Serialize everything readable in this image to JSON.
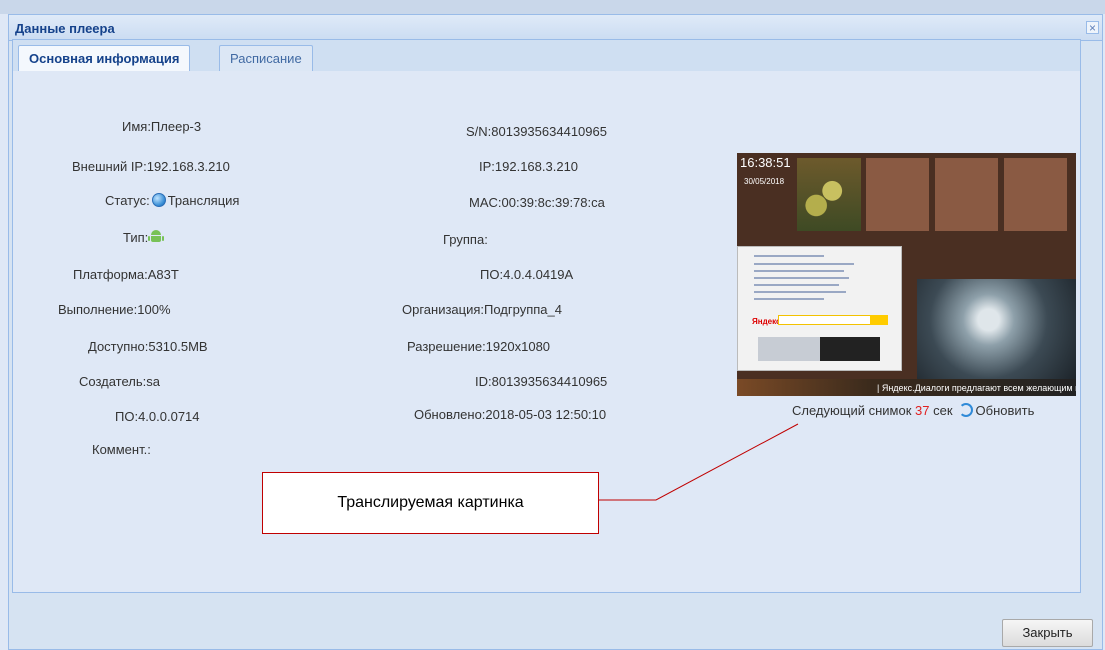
{
  "window": {
    "title": "Данные плеера",
    "close_glyph": "×"
  },
  "tabs": [
    {
      "label": "Основная информация",
      "active": true
    },
    {
      "label": "Расписание",
      "active": false
    }
  ],
  "left_fields": {
    "name": "Имя:Плеер-3",
    "ext_ip": "Внешний IP:192.168.3.210",
    "status_label": "Статус:",
    "status_value": "Трансляция",
    "type_label": "Тип:",
    "platform": "Платформа:A83T",
    "progress": "Выполнение:100%",
    "available": "Доступно:5310.5MB",
    "creator": "Создатель:sa",
    "software": "ПО:4.0.0.0714",
    "comment": "Коммент.:"
  },
  "right_fields": {
    "sn": "S/N:8013935634410965",
    "ip": "IP:192.168.3.210",
    "mac": "MAC:00:39:8c:39:78:ca",
    "group": "Группа:",
    "software": "ПО:4.0.4.0419A",
    "organization": "Организация:Подгруппа_4",
    "resolution": "Разрешение:1920x1080",
    "id": "ID:8013935634410965",
    "updated": "Обновлено:2018-05-03 12:50:10"
  },
  "preview": {
    "time": "16:38:51",
    "date": "30/05/2018",
    "ticker": "| Яндекс.Диалоги предлагают всем желающим научить А",
    "web_logo": "Яндекс"
  },
  "snapshot": {
    "prefix": "Следующий снимок",
    "seconds": "37",
    "unit": "сек",
    "refresh_label": "Обновить"
  },
  "callout": {
    "text": "Транслируемая картинка"
  },
  "footer": {
    "close_label": "Закрыть"
  },
  "icons": {
    "status": "broadcast-status-icon",
    "type": "android-icon",
    "refresh": "refresh-icon"
  },
  "colors": {
    "title_text": "#15428b",
    "countdown": "#e02020",
    "callout_border": "#c00000",
    "frame_border": "#99bbe8"
  }
}
